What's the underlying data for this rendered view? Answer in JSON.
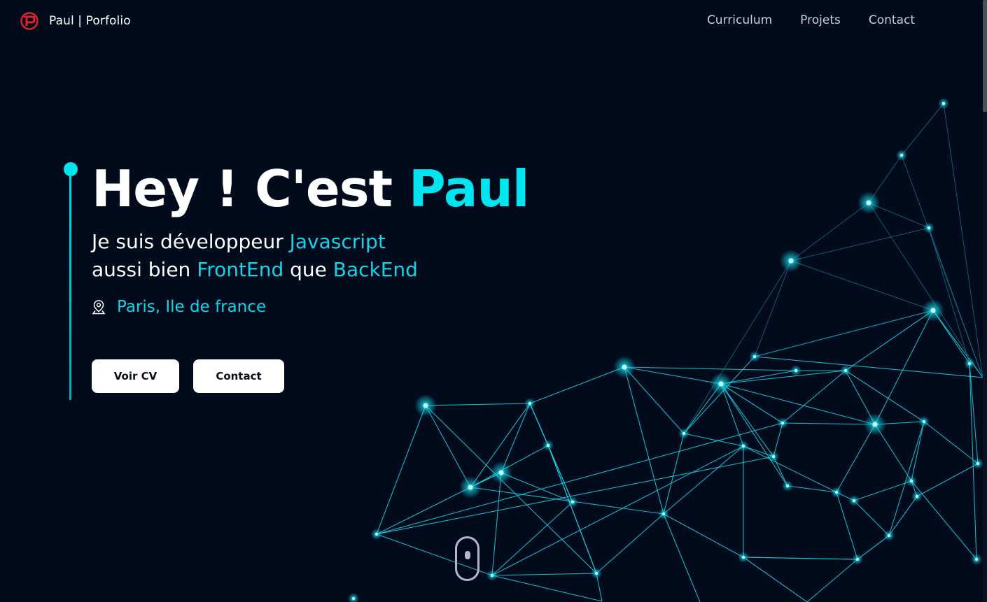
{
  "navbar": {
    "brand_text": "Paul | Porfolio",
    "logo_icon": "p-logo-icon",
    "links": [
      {
        "label": "Curriculum"
      },
      {
        "label": "Projets"
      },
      {
        "label": "Contact"
      }
    ]
  },
  "hero": {
    "title_start": "Hey ! C'est ",
    "title_name": "Paul",
    "line1_start": "Je suis développeur ",
    "line1_accent": "Javascript",
    "line2_start": "aussi bien ",
    "line2_accent1": "FrontEnd",
    "line2_mid": " que ",
    "line2_accent2": "BackEnd",
    "location_icon": "location-pin-icon",
    "location": "Paris, Ile de france",
    "buttons": {
      "cv_label": "Voir CV",
      "contact_label": "Contact"
    },
    "scroll_icon": "scroll-mouse-icon"
  },
  "colors": {
    "background": "#020b1c",
    "accent": "#00e5f0",
    "logo_red": "#e0202a",
    "nav_text": "#c9cfdc",
    "network_line": "#16d3e6"
  }
}
